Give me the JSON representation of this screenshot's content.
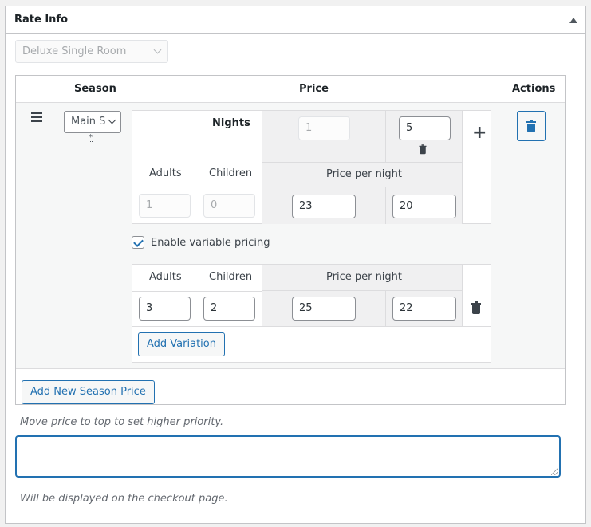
{
  "panel": {
    "title": "Rate Info",
    "toggle_icon": "triangle-up-icon"
  },
  "room_select": {
    "value": "Deluxe Single Room",
    "disabled": true
  },
  "table": {
    "headers": {
      "season": "Season",
      "price": "Price",
      "actions": "Actions"
    },
    "season_row": {
      "drag_icon": "hamburger-icon",
      "season_value": "Main S",
      "required_mark": "*",
      "price": {
        "nights_label": "Nights",
        "nights_base": "1",
        "nights_extra": "5",
        "adults_label": "Adults",
        "children_label": "Children",
        "adults_value": "1",
        "children_value": "0",
        "price_per_night_label": "Price per night",
        "price_base": "23",
        "price_extra": "20"
      },
      "variable_pricing": {
        "label": "Enable variable pricing",
        "checked": true,
        "adults_label": "Adults",
        "children_label": "Children",
        "price_per_night_label": "Price per night",
        "variations": [
          {
            "adults": "3",
            "children": "2",
            "price_base": "25",
            "price_extra": "22"
          }
        ],
        "add_variation_label": "Add Variation"
      }
    },
    "add_season_label": "Add New Season Price"
  },
  "hints": {
    "priority": "Move price to top to set higher priority.",
    "checkout": "Will be displayed on the checkout page."
  },
  "notes_textarea": {
    "value": ""
  },
  "colors": {
    "accent": "#2271b1",
    "border": "#c3c4c7",
    "gray_cell": "#f0f0f1"
  }
}
